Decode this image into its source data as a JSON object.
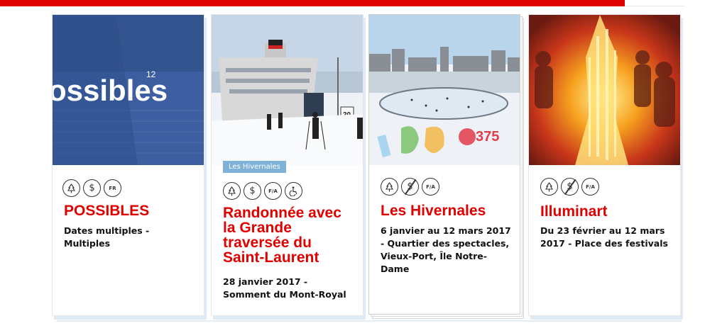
{
  "cards": [
    {
      "title": "POSSIBLES",
      "description": "Dates multiples - Multiples",
      "image_text": "ossibles",
      "image_superscript": "12",
      "icons": [
        "tree-icon",
        "dollar-icon",
        "fr-icon"
      ],
      "icon_labels": {
        "fr": "FR"
      }
    },
    {
      "tag": "Les Hivernales",
      "title": "Randonnée avec la Grande traversée du Saint-Laurent",
      "description": "28 janvier 2017 - Somment du Mont-Royal",
      "image_sign": "20",
      "icons": [
        "tree-icon",
        "dollar-icon",
        "fa-icon",
        "wheelchair-icon"
      ],
      "icon_labels": {
        "fa": "F/A"
      }
    },
    {
      "title": "Les Hivernales",
      "description": "6 janvier au 12 mars 2017 - Quartier des spectacles, Vieux-Port, Île Notre-Dame",
      "image_text": "375",
      "icons": [
        "tree-icon",
        "no-dollar-icon",
        "fa-icon"
      ],
      "icon_labels": {
        "fa": "F/A"
      }
    },
    {
      "title": "Illuminart",
      "description": "Du 23 février au 12 mars 2017 - Place des festivals",
      "icons": [
        "tree-icon",
        "no-dollar-icon",
        "fa-icon"
      ],
      "icon_labels": {
        "fa": "F/A"
      }
    }
  ],
  "colors": {
    "accent": "#e10000",
    "tag_bg": "#7fb2d8",
    "shadow": "#dfeaf4"
  }
}
